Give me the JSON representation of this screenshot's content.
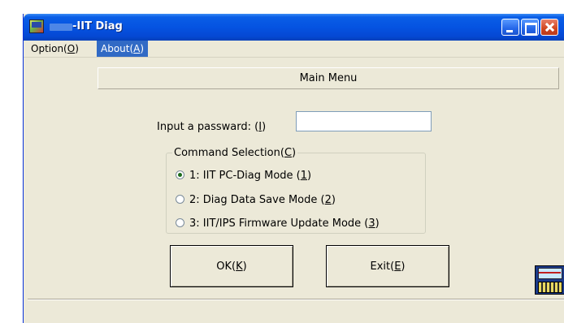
{
  "window": {
    "title": "-IIT Diag",
    "icon": "app-monitor-icon"
  },
  "titlebar_buttons": {
    "minimize_icon": "minimize-icon",
    "maximize_icon": "maximize-icon",
    "close_icon": "close-icon"
  },
  "menu": {
    "option_label": "Option(",
    "option_key": "O",
    "option_end": ")",
    "about_label": "About(",
    "about_key": "A",
    "about_end": ")"
  },
  "main_menu": {
    "label": "Main Menu"
  },
  "password": {
    "label": "Input a passward: (",
    "key": "I",
    "end": ")",
    "value": "",
    "placeholder": ""
  },
  "command_selection": {
    "legend_label": "Command Selection(",
    "legend_key": "C",
    "legend_end": ")",
    "options": [
      {
        "label": "1: IIT PC-Diag Mode (",
        "key": "1",
        "end": ")",
        "selected": true
      },
      {
        "label": "2: Diag Data Save Mode (",
        "key": "2",
        "end": ")",
        "selected": false
      },
      {
        "label": "3: IIT/IPS Firmware Update Mode (",
        "key": "3",
        "end": ")",
        "selected": false
      }
    ]
  },
  "buttons": {
    "ok_label": "OK(",
    "ok_key": "K",
    "ok_end": ")",
    "exit_label": "Exit(",
    "exit_key": "E",
    "exit_end": ")"
  },
  "colors": {
    "titlebar": "#0553e1",
    "menu_highlight": "#316ac5",
    "window_bg": "#ece9d8"
  }
}
